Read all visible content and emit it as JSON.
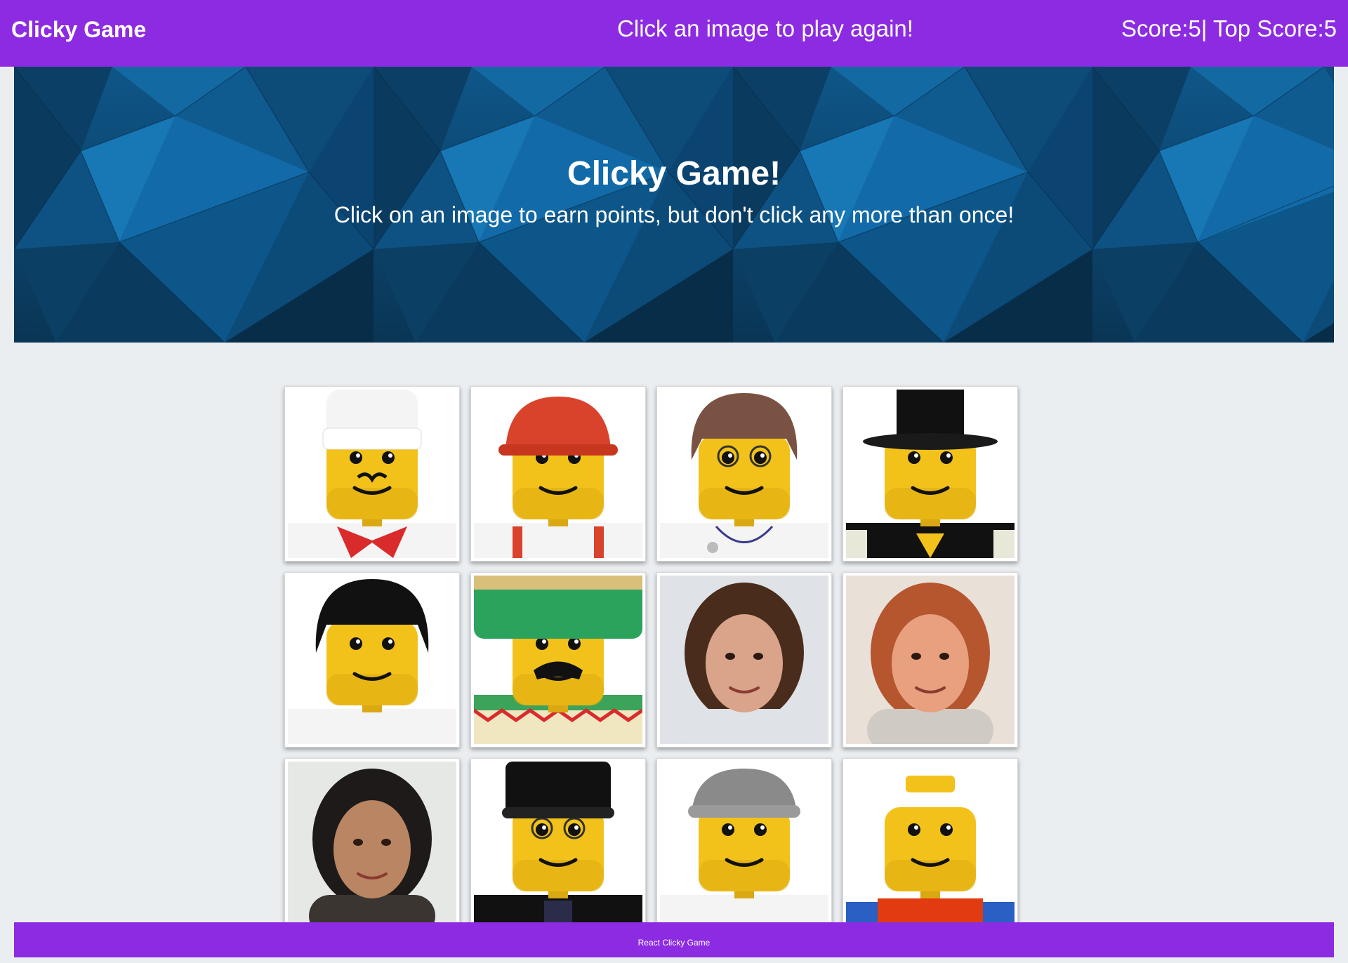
{
  "navbar": {
    "brand": "Clicky Game",
    "message": "Click an image to play again!",
    "score_text": "Score:5| Top Score:5",
    "color": "#8c2be2"
  },
  "jumbotron": {
    "title": "Clicky Game!",
    "subtitle": "Click on an image to earn points, but don't click any more than once!"
  },
  "cards": [
    {
      "name": "chef-minifig-card",
      "kind": "lego",
      "hat": "chef",
      "shirt": "chef"
    },
    {
      "name": "construction-minifig-card",
      "kind": "lego",
      "hat": "hardhat",
      "shirt": "overalls"
    },
    {
      "name": "doctor-minifig-card",
      "kind": "lego",
      "hat": "hair-brown",
      "shirt": "doctor"
    },
    {
      "name": "tophat-minifig-card",
      "kind": "lego",
      "hat": "tophat",
      "shirt": "tux"
    },
    {
      "name": "black-hair-minifig-card",
      "kind": "lego",
      "hat": "hair-black",
      "shirt": "white"
    },
    {
      "name": "sombrero-minifig-card",
      "kind": "lego",
      "hat": "sombrero",
      "shirt": "poncho"
    },
    {
      "name": "woman-photo-card",
      "kind": "photo",
      "bg": "#dfe2e6",
      "hair": "#4a2c1c",
      "skin": "#d9a48a",
      "shirt": "#dfe2e6"
    },
    {
      "name": "excited-man-photo-card",
      "kind": "photo",
      "bg": "#e9e0d8",
      "hair": "#b5562e",
      "skin": "#e8a07f",
      "shirt": "#cfcac4"
    },
    {
      "name": "bearded-man-photo-card",
      "kind": "photo",
      "bg": "#e6e8e6",
      "hair": "#1d1a19",
      "skin": "#b98562",
      "shirt": "#3b3532"
    },
    {
      "name": "police-minifig-card",
      "kind": "lego",
      "hat": "police",
      "shirt": "police"
    },
    {
      "name": "grey-cap-minifig-card",
      "kind": "lego",
      "hat": "greycap",
      "shirt": "white"
    },
    {
      "name": "bald-minifig-card",
      "kind": "lego",
      "hat": "none",
      "shirt": "red"
    }
  ],
  "footer": {
    "text": "React Clicky Game"
  }
}
